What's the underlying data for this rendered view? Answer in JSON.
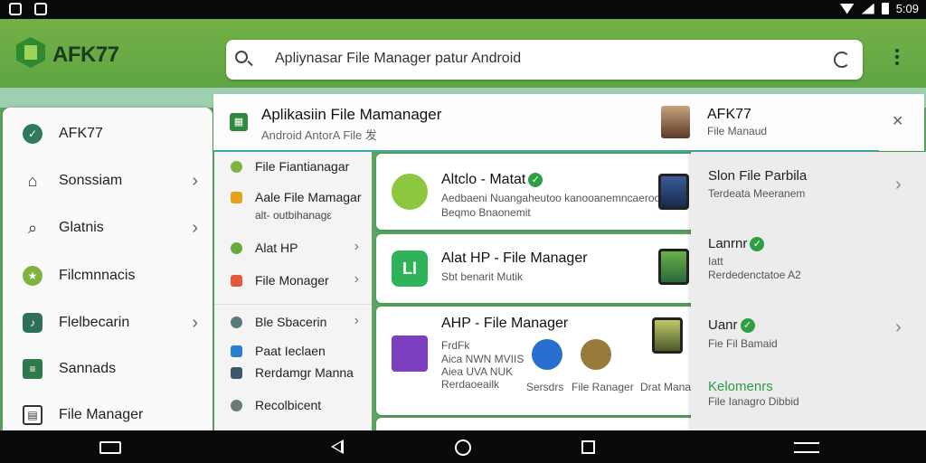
{
  "status_bar": {
    "time": "5:09",
    "icons": [
      "app-icon-a",
      "app-icon-b",
      "wifi-icon",
      "signal-icon",
      "battery-icon"
    ]
  },
  "header": {
    "brand": "AFK77",
    "search_text": "Apliynasar File Manager patur Android",
    "search_icon": "search-icon",
    "refresh_icon": "refresh-icon",
    "menu_icon": "more-vertical-icon"
  },
  "drawer": {
    "items": [
      {
        "label": "AFK77",
        "icon": "check-icon",
        "chevron": false
      },
      {
        "label": "Sonssiam",
        "icon": "home-icon",
        "chevron": true
      },
      {
        "label": "Glatnis",
        "icon": "search-icon",
        "chevron": true
      },
      {
        "label": "Filcmnnacis",
        "icon": "star-icon",
        "chevron": false
      },
      {
        "label": "Flelbecarin",
        "icon": "music-icon",
        "chevron": true
      },
      {
        "label": "Sannads",
        "icon": "list-icon",
        "chevron": false
      },
      {
        "label": "File Manager",
        "icon": "folder-icon",
        "chevron": false
      }
    ]
  },
  "top_strip": {
    "title": "Aplikasiin File Mamanager",
    "subtitle": "Android AntorA File 发",
    "profile_name": "AFK77",
    "profile_sub": "File Manaud"
  },
  "submenu": {
    "items": [
      {
        "label": "File Fiantianagar",
        "sub": "",
        "color": "#7fb33d",
        "chevron": false
      },
      {
        "label": "Aale File Mamagar",
        "sub": "alt- outbihanagε",
        "color": "#e3a21a",
        "chevron": false
      },
      {
        "label": "Alat HP",
        "sub": "",
        "color": "#6aa83a",
        "chevron": true
      },
      {
        "label": "File Monager",
        "sub": "",
        "color": "#e4573d",
        "chevron": true
      },
      {
        "label": "Ble Sbacerin",
        "sub": "",
        "color": "#5a7a7a",
        "chevron": true
      },
      {
        "label": "Paat Ieclaen",
        "sub": "",
        "color": "#2a7fd0",
        "chevron": false
      },
      {
        "label": "Rerdamgr Manna",
        "sub": "",
        "color": "#3a5a6a",
        "chevron": false
      },
      {
        "label": "Recolbicent",
        "sub": "",
        "color": "#6a7a7a",
        "chevron": false
      }
    ]
  },
  "cards": [
    {
      "title": "Altclo - Matat",
      "line1": "Aedbaeni Nuangaheutoo kanooanemncaeroosi",
      "line2": "Beqmo Bnaonemit",
      "icon_color": "#8dc63f"
    },
    {
      "title": "Alat HP - File Manager",
      "line1": "Sbt benarit Mutik",
      "line2": "",
      "icon_color": "#2fb35a"
    },
    {
      "title": "AHP - File Manager",
      "line1": "FrdFk",
      "line2": "Aica NWN MVIIS",
      "line3": "Aiea UVA NUK",
      "line4": "Rerdaoeailk",
      "captions": [
        "Sersdrs",
        "File Ranager",
        "Drat Manag"
      ],
      "icon_color": "#7b3fbf"
    }
  ],
  "right_panel": {
    "items": [
      {
        "title": "Slon File Parbila",
        "sub": "Terdeata Meeranem",
        "chevron": true,
        "title_color": "#222"
      },
      {
        "title": "Lanrnr",
        "sub": "Rerdedenctatoe A2",
        "sub_top": "Iatt",
        "chevron": false,
        "verified": true,
        "title_color": "#222"
      },
      {
        "title": "Uanr",
        "sub": "Fie Fil Bamaid",
        "chevron": true,
        "verified": true,
        "title_color": "#222"
      },
      {
        "title": "Kelomenrs",
        "sub": "File Ianagro Dibbid",
        "chevron": false,
        "title_color": "#2e9b44"
      }
    ]
  },
  "nav_bar": [
    "rotate-icon",
    "back-icon",
    "home-icon",
    "recents-icon",
    "switch-icon"
  ]
}
